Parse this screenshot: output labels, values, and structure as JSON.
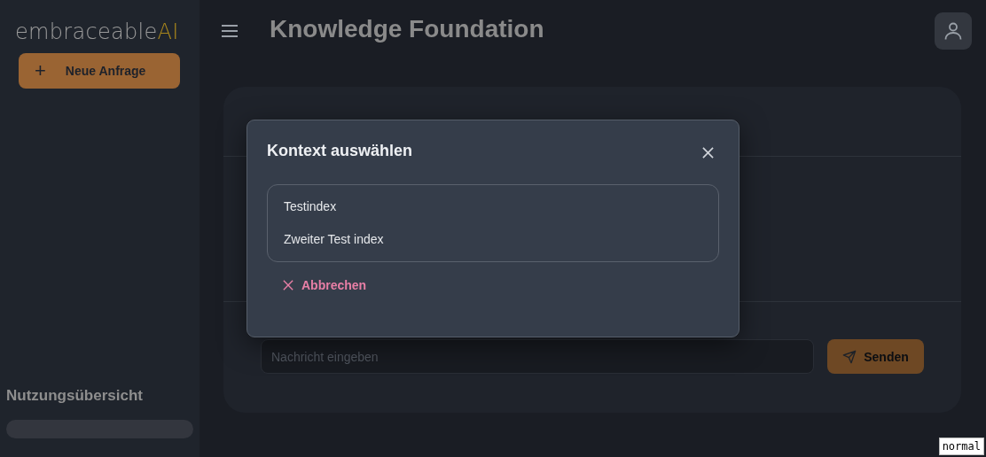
{
  "sidebar": {
    "logo": {
      "main": "embraceable",
      "accent": "AI"
    },
    "new_button": {
      "icon": "+",
      "label": "Neue Anfrage"
    },
    "usage": {
      "title": "Nutzungsübersicht"
    }
  },
  "header": {
    "title": "Knowledge Foundation"
  },
  "chat": {
    "input": {
      "placeholder": "Nachricht eingeben"
    },
    "send_button": "Senden"
  },
  "modal": {
    "title": "Kontext auswählen",
    "options": [
      {
        "label": "Testindex"
      },
      {
        "label": "Zweiter Test index"
      }
    ],
    "cancel_button": "Abbrechen"
  },
  "mode_badge": "normal"
}
